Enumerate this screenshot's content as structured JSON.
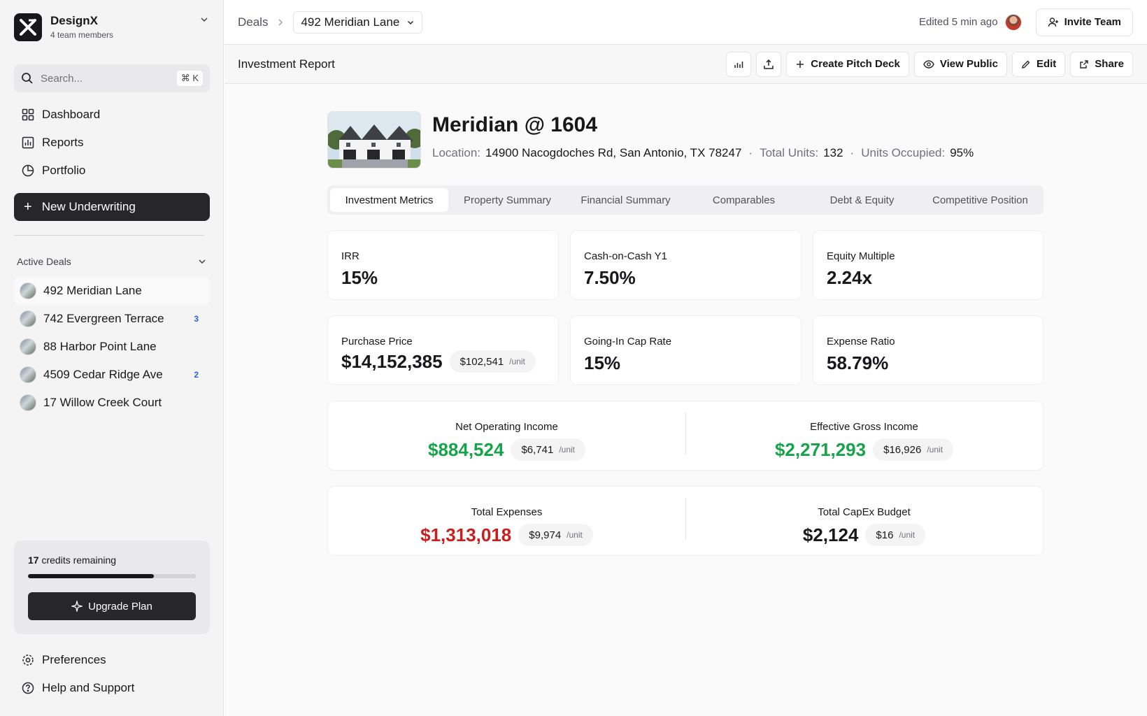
{
  "brand": {
    "name": "DesignX",
    "members": "4 team members"
  },
  "search": {
    "placeholder": "Search...",
    "shortcut": "⌘ K"
  },
  "nav": [
    {
      "label": "Dashboard",
      "icon": "grid-icon"
    },
    {
      "label": "Reports",
      "icon": "bar-chart-icon"
    },
    {
      "label": "Portfolio",
      "icon": "pie-chart-icon"
    }
  ],
  "new_underwriting": "New Underwriting",
  "active_deals": {
    "heading": "Active Deals",
    "items": [
      {
        "label": "492 Meridian Lane",
        "badge": ""
      },
      {
        "label": "742 Evergreen Terrace",
        "badge": "3"
      },
      {
        "label": "88 Harbor Point Lane",
        "badge": ""
      },
      {
        "label": "4509 Cedar Ridge Ave",
        "badge": "2"
      },
      {
        "label": "17 Willow Creek Court",
        "badge": ""
      }
    ]
  },
  "credits": {
    "count": "17",
    "text": "credits remaining",
    "used_fraction": 0.75,
    "upgrade": "Upgrade Plan"
  },
  "footer_nav": [
    {
      "label": "Preferences",
      "icon": "gear-icon"
    },
    {
      "label": "Help and Support",
      "icon": "help-icon"
    }
  ],
  "topbar": {
    "breadcrumb": "Deals",
    "deal": "492 Meridian Lane",
    "edited": "Edited 5 min ago",
    "invite": "Invite Team"
  },
  "toolbar": {
    "title": "Investment Report",
    "create_pitch": "Create Pitch Deck",
    "view_public": "View Public",
    "edit": "Edit",
    "share": "Share"
  },
  "property": {
    "title": "Meridian @ 1604",
    "location_label": "Location:",
    "location": "14900 Nacogdoches Rd, San Antonio, TX 78247",
    "units_label": "Total Units:",
    "units": "132",
    "occupied_label": "Units Occupied:",
    "occupied": "95%"
  },
  "tabs": [
    "Investment Metrics",
    "Property Summary",
    "Financial Summary",
    "Comparables",
    "Debt & Equity",
    "Competitive Position"
  ],
  "metrics": [
    {
      "label": "IRR",
      "value": "15%"
    },
    {
      "label": "Cash-on-Cash Y1",
      "value": "7.50%"
    },
    {
      "label": "Equity Multiple",
      "value": "2.24x"
    },
    {
      "label": "Purchase Price",
      "value": "$14,152,385",
      "per_unit": "$102,541",
      "unit": "/unit"
    },
    {
      "label": "Going-In Cap Rate",
      "value": "15%"
    },
    {
      "label": "Expense Ratio",
      "value": "58.79%"
    }
  ],
  "income": {
    "noi": {
      "label": "Net Operating Income",
      "value": "$884,524",
      "per_unit": "$6,741",
      "unit": "/unit"
    },
    "egi": {
      "label": "Effective Gross Income",
      "value": "$2,271,293",
      "per_unit": "$16,926",
      "unit": "/unit"
    }
  },
  "expenses": {
    "total": {
      "label": "Total Expenses",
      "value": "$1,313,018",
      "per_unit": "$9,974",
      "unit": "/unit"
    },
    "capex": {
      "label": "Total CapEx Budget",
      "value": "$2,124",
      "per_unit": "$16",
      "unit": "/unit"
    }
  },
  "colors": {
    "positive": "#16a34a",
    "negative": "#c81e1e",
    "dark": "#18181b"
  }
}
